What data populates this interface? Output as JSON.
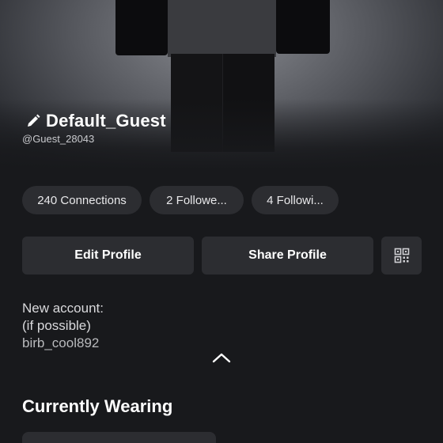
{
  "profile": {
    "display_name": "Default_Guest",
    "username": "@Guest_28043"
  },
  "stats": [
    {
      "label": "240 Connections"
    },
    {
      "label": "2 Followe..."
    },
    {
      "label": "4 Followi..."
    }
  ],
  "actions": {
    "edit_label": "Edit Profile",
    "share_label": "Share Profile",
    "qr_icon": "qr-code-icon"
  },
  "bio": {
    "line1": "New account:",
    "line2": "(if possible)",
    "line3": "birb_cool892"
  },
  "sections": {
    "currently_wearing": "Currently Wearing"
  }
}
